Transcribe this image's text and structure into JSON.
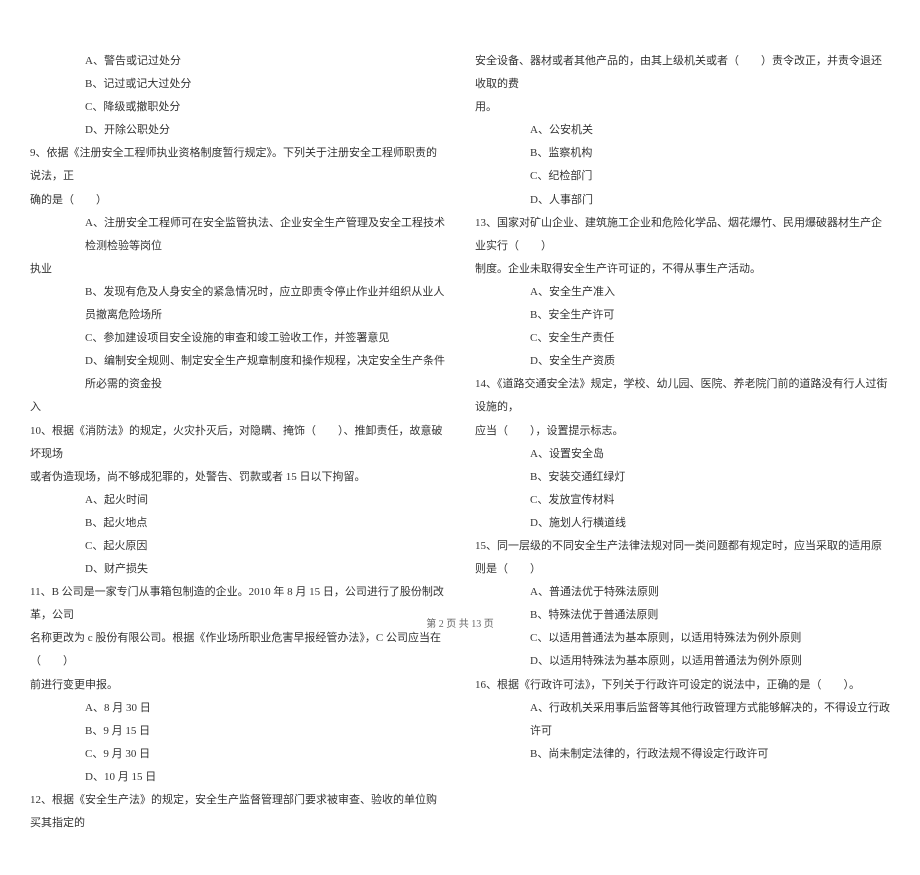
{
  "left": {
    "q8_opts": {
      "a": "A、警告或记过处分",
      "b": "B、记过或记大过处分",
      "c": "C、降级或撤职处分",
      "d": "D、开除公职处分"
    },
    "q9": {
      "line1": "9、依据《注册安全工程师执业资格制度暂行规定》。下列关于注册安全工程师职责的说法，正",
      "line2": "确的是（　　）",
      "a1": "A、注册安全工程师可在安全监管执法、企业安全生产管理及安全工程技术检测检验等岗位",
      "a2": "执业",
      "b": "B、发现有危及人身安全的紧急情况时，应立即责令停止作业并组织从业人员撤离危险场所",
      "c": "C、参加建设项目安全设施的审查和竣工验收工作，并签署意见",
      "d1": "D、编制安全规则、制定安全生产规章制度和操作规程，决定安全生产条件所必需的资金投",
      "d2": "入"
    },
    "q10": {
      "line1": "10、根据《消防法》的规定，火灾扑灭后，对隐瞒、掩饰（　　）、推卸责任，故意破坏现场",
      "line2": "或者伪造现场，尚不够成犯罪的，处警告、罚款或者 15 日以下拘留。",
      "a": "A、起火时间",
      "b": "B、起火地点",
      "c": "C、起火原因",
      "d": "D、财产损失"
    },
    "q11": {
      "line1": "11、B 公司是一家专门从事箱包制造的企业。2010 年 8 月 15 日，公司进行了股份制改革，公司",
      "line2": "名称更改为 c 股份有限公司。根据《作业场所职业危害早报经管办法》，C 公司应当在（　　）",
      "line3": "前进行变更申报。",
      "a": "A、8 月 30 日",
      "b": "B、9 月 15 日",
      "c": "C、9 月 30 日",
      "d": "D、10 月 15 日"
    },
    "q12": {
      "line1": "12、根据《安全生产法》的规定，安全生产监督管理部门要求被审查、验收的单位购买其指定的"
    }
  },
  "right": {
    "q12_cont": {
      "line1": "安全设备、器材或者其他产品的，由其上级机关或者（　　）责令改正，并责令退还收取的费",
      "line2": "用。",
      "a": "A、公安机关",
      "b": "B、监察机构",
      "c": "C、纪检部门",
      "d": "D、人事部门"
    },
    "q13": {
      "line1": "13、国家对矿山企业、建筑施工企业和危险化学品、烟花爆竹、民用爆破器材生产企业实行（　　）",
      "line2": "制度。企业未取得安全生产许可证的，不得从事生产活动。",
      "a": "A、安全生产准入",
      "b": "B、安全生产许可",
      "c": "C、安全生产责任",
      "d": "D、安全生产资质"
    },
    "q14": {
      "line1": "14、《道路交通安全法》规定，学校、幼儿园、医院、养老院门前的道路没有行人过街设施的，",
      "line2": "应当（　　），设置提示标志。",
      "a": "A、设置安全岛",
      "b": "B、安装交通红绿灯",
      "c": "C、发放宣传材料",
      "d": "D、施划人行横道线"
    },
    "q15": {
      "line1": "15、同一层级的不同安全生产法律法规对同一类问题都有规定时，应当采取的适用原则是（　　）",
      "a": "A、普通法优于特殊法原则",
      "b": "B、特殊法优于普通法原则",
      "c": "C、以适用普通法为基本原则，以适用特殊法为例外原则",
      "d": "D、以适用特殊法为基本原则，以适用普通法为例外原则"
    },
    "q16": {
      "line1": "16、根据《行政许可法》，下列关于行政许可设定的说法中，正确的是（　　）。",
      "a": "A、行政机关采用事后监督等其他行政管理方式能够解决的，不得设立行政许可",
      "b": "B、尚未制定法律的，行政法规不得设定行政许可"
    }
  },
  "footer": "第 2 页 共 13 页"
}
